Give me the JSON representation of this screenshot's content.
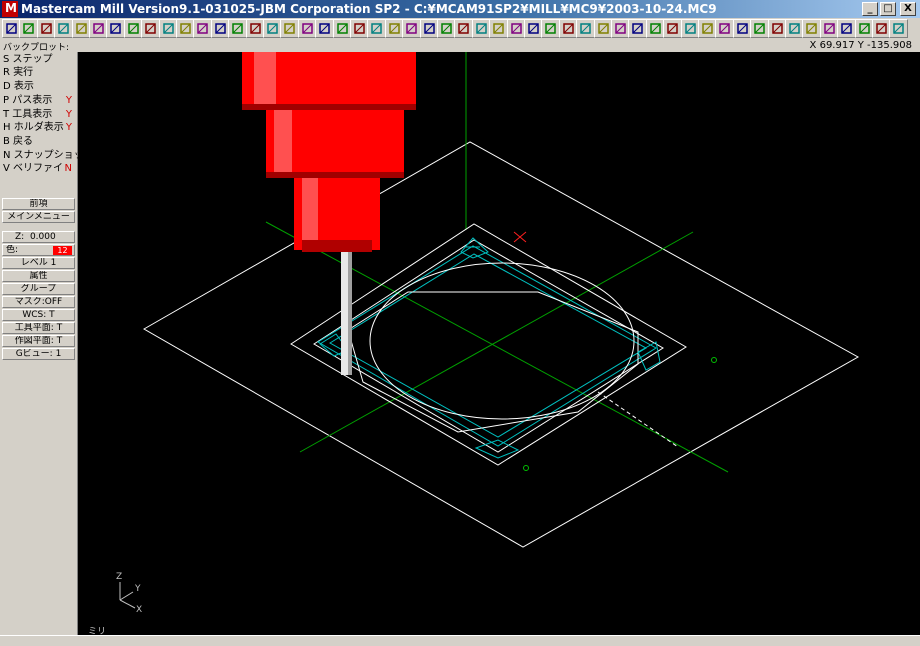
{
  "window": {
    "title": "Mastercam Mill Version9.1-031025-JBM Corporation SP2 - C:¥MCAM91SP2¥MILL¥MC9¥2003-10-24.MC9",
    "controls": {
      "minimize": "_",
      "maximize": "□",
      "close": "X"
    }
  },
  "toolbar": {
    "icons": [
      "arrow-left-icon",
      "arrow-right-icon",
      "help-icon",
      "calculator-icon",
      "undo-icon",
      "zoom-window-icon",
      "zoom-in-icon",
      "zoom-out-icon",
      "pan-icon",
      "window-icon",
      "view-cube-icon",
      "view-cube-icon",
      "view-cube-icon",
      "view-cube-icon",
      "view-cube-icon",
      "view-cube-icon",
      "view-cube-icon",
      "view-cube-icon",
      "view-cube-icon",
      "pencil-icon",
      "no-entry-icon",
      "analyze-icon",
      "circle-arrow-icon",
      "sphere-icon",
      "layers-icon",
      "sigma-icon",
      "line-icon",
      "arc-icon",
      "fillet-icon",
      "spline-icon",
      "rectangle-icon",
      "point-icon",
      "surface-icon",
      "solid-icon",
      "toolpath-icon",
      "chamfer-icon",
      "trim-icon",
      "extend-icon",
      "break-icon",
      "join-icon",
      "modify-icon",
      "transform-icon",
      "mirror-icon",
      "rotate-icon",
      "scale-icon",
      "offset-icon",
      "drill-icon",
      "contour-icon",
      "pocket-icon",
      "backplot-icon",
      "verify-icon",
      "redo-icon"
    ]
  },
  "status": {
    "mode_label": "バックプロット:",
    "coordinates": "X 69.917  Y -135.908"
  },
  "menu": {
    "items": [
      {
        "label": "S ステップ",
        "flag": ""
      },
      {
        "label": "R 実行",
        "flag": ""
      },
      {
        "label": "D 表示",
        "flag": ""
      },
      {
        "label": "P パス表示",
        "flag": "Y"
      },
      {
        "label": "T 工具表示",
        "flag": "Y"
      },
      {
        "label": "H ホルダ表示",
        "flag": "Y"
      },
      {
        "label": "B 戻る",
        "flag": ""
      },
      {
        "label": "N スナップショット",
        "flag": ""
      },
      {
        "label": "V ベリファイ",
        "flag": "N"
      }
    ],
    "nav_buttons": [
      "前項",
      "メインメニュー"
    ],
    "z_label": "Z:",
    "z_value": "0.000",
    "color_label": "色:",
    "color_value": "12",
    "settings_buttons": [
      "レベル 1",
      "属性",
      "グループ",
      "マスク:OFF",
      "WCS: T",
      "工具平面: T",
      "作図平面: T",
      "Gビュー: 1"
    ],
    "colors": {
      "flag": "#d00000",
      "color_swatch": "#ff0000"
    }
  },
  "viewport": {
    "axis_labels": {
      "z": "Z",
      "y": "Y",
      "x": "X"
    },
    "unit_label": "ミリ",
    "colors": {
      "tool": "#ff0000",
      "holder_shadow": "#a00000",
      "toolpath": "#00c0c0",
      "axis": "#00a000",
      "geometry": "#ffffff",
      "marker": "#ff2020"
    }
  }
}
